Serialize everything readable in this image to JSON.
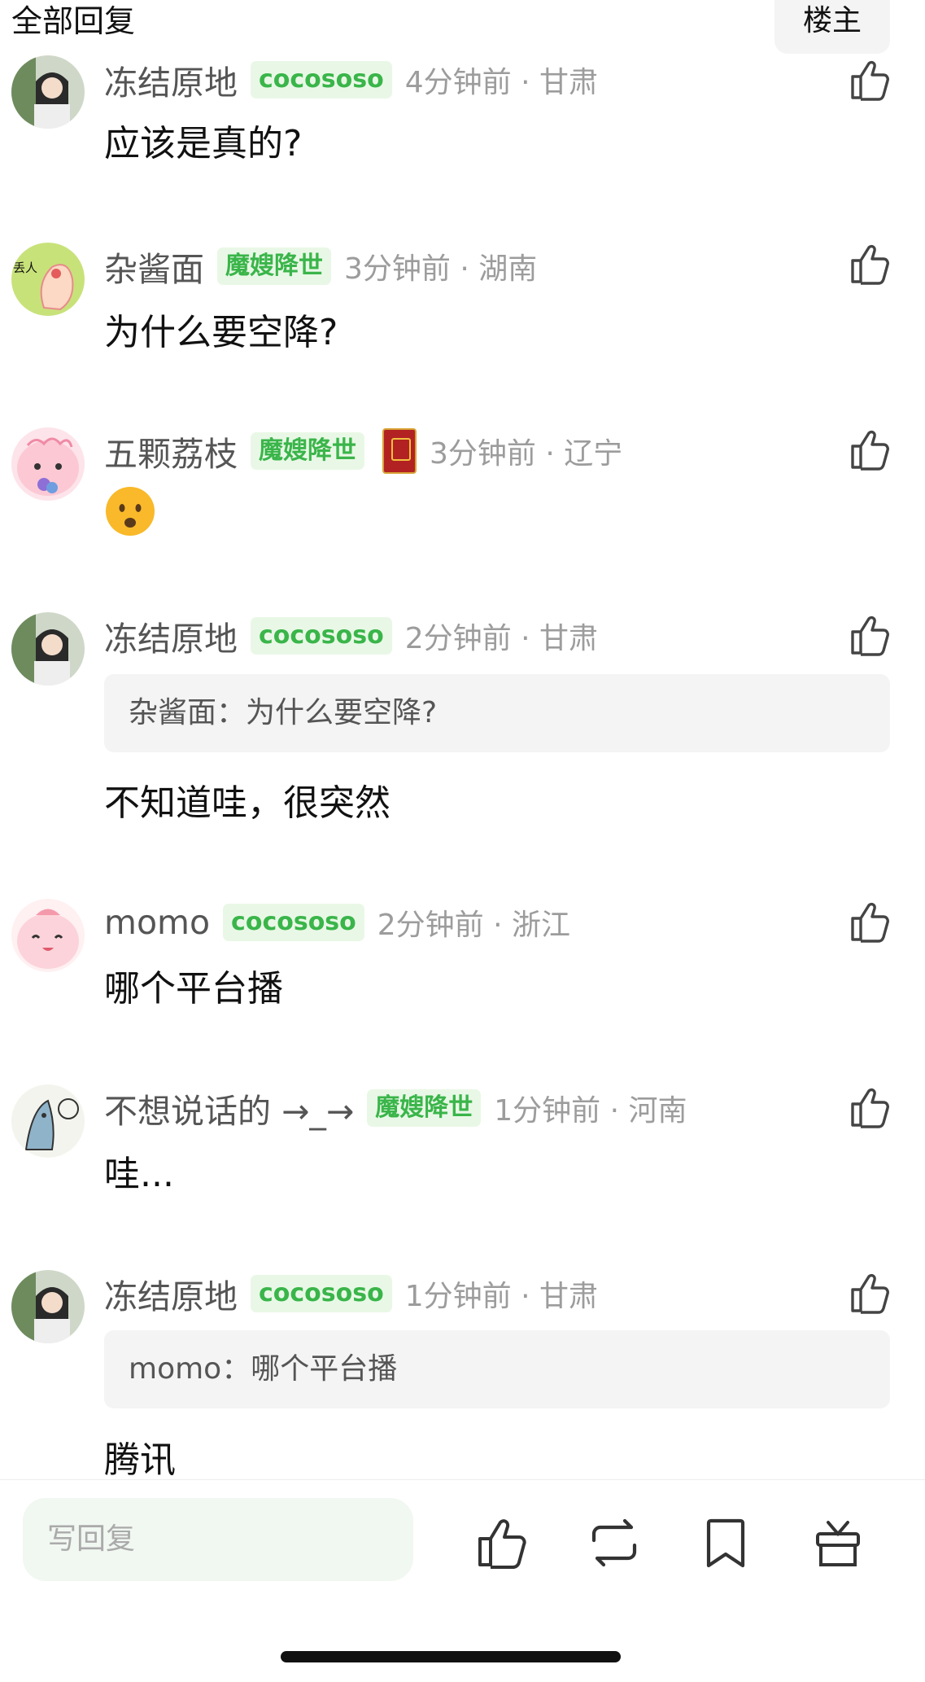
{
  "header": {
    "title": "全部回复",
    "op_button": "楼主"
  },
  "comments": [
    {
      "user": "冻结原地",
      "badge": "cocososo",
      "meta": "4分钟前 · 甘肃",
      "text": "应该是真的?"
    },
    {
      "user": "杂酱面",
      "badge": "魔嫂降世",
      "meta": "3分钟前 · 湖南",
      "text": "为什么要空降?",
      "avatar_text": "丢人"
    },
    {
      "user": "五颗荔枝",
      "badge": "魔嫂降世",
      "meta": "3分钟前 · 辽宁",
      "emoji": "frowning-face"
    },
    {
      "user": "冻结原地",
      "badge": "cocososo",
      "meta": "2分钟前 · 甘肃",
      "quote": "杂酱面：为什么要空降?",
      "text": "不知道哇，很突然"
    },
    {
      "user": "momo",
      "badge": "cocososo",
      "meta": "2分钟前 · 浙江",
      "text": "哪个平台播"
    },
    {
      "user": "不想说话的 →_→",
      "badge": "魔嫂降世",
      "meta": "1分钟前 · 河南",
      "text": "哇..."
    },
    {
      "user": "冻结原地",
      "badge": "cocososo",
      "meta": "1分钟前 · 甘肃",
      "quote": "momo：哪个平台播",
      "text": "腾讯"
    }
  ],
  "bottombar": {
    "reply_placeholder": "写回复",
    "icons": [
      "thumbs-up-icon",
      "repost-icon",
      "bookmark-icon",
      "gift-icon"
    ]
  },
  "colors": {
    "badge_green": "#3ab54a",
    "badge_bg": "#e9f8e6",
    "meta_gray": "#9c9c9c",
    "input_bg": "#f1f7f1"
  }
}
